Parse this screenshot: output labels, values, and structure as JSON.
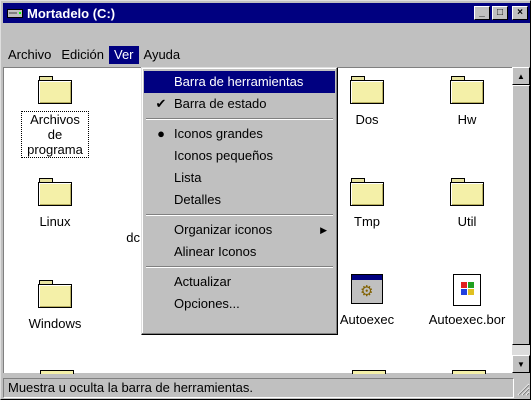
{
  "window": {
    "title": "Mortadelo (C:)",
    "controls": {
      "minimize": "_",
      "maximize": "□",
      "close": "×"
    }
  },
  "menubar": {
    "items": [
      {
        "label": "Archivo"
      },
      {
        "label": "Edición"
      },
      {
        "label": "Ver"
      },
      {
        "label": "Ayuda"
      }
    ]
  },
  "icons": [
    {
      "label": "Archivos de programa",
      "type": "folder"
    },
    {
      "label": "Dos",
      "type": "folder"
    },
    {
      "label": "Hw",
      "type": "folder"
    },
    {
      "label": "Linux",
      "type": "folder"
    },
    {
      "label": "dc",
      "type": "folder"
    },
    {
      "label": "Tmp",
      "type": "folder"
    },
    {
      "label": "Util",
      "type": "folder"
    },
    {
      "label": "Windows",
      "type": "folder"
    },
    {
      "label": "Autoexec",
      "type": "app"
    },
    {
      "label": "Autoexec.bor",
      "type": "doc"
    }
  ],
  "dropdown": {
    "items": [
      {
        "label": "Barra de herramientas",
        "highlighted": true
      },
      {
        "label": "Barra de estado",
        "check": "✔"
      },
      {
        "label": "Iconos grandes",
        "check": "●"
      },
      {
        "label": "Iconos pequeños"
      },
      {
        "label": "Lista"
      },
      {
        "label": "Detalles"
      },
      {
        "label": "Organizar iconos",
        "submenu": "▶"
      },
      {
        "label": "Alinear Iconos"
      },
      {
        "label": "Actualizar"
      },
      {
        "label": "Opciones..."
      }
    ]
  },
  "statusbar": {
    "text": "Muestra u oculta la barra de herramientas."
  },
  "colors": {
    "titlebar": "#000080",
    "highlight": "#000080",
    "folder": "#f4f0a8"
  }
}
